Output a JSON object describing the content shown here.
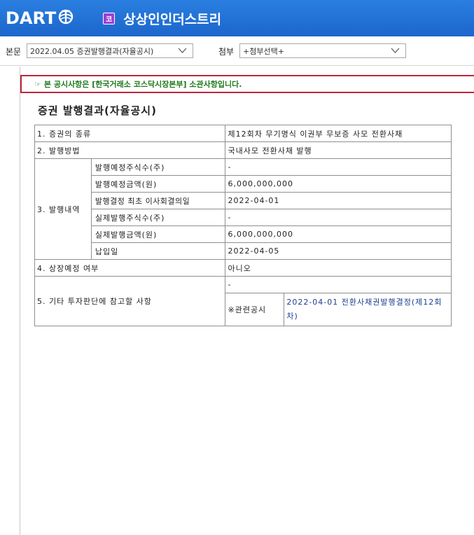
{
  "header": {
    "logo_text": "DART",
    "company_badge": "코",
    "company_name": "상상인인더스트리"
  },
  "toolbar": {
    "main_label": "본문",
    "main_select": "2022.04.05  증권발행결과(자율공시)",
    "attach_label": "첨부",
    "attach_select": "+첨부선택+"
  },
  "notice": {
    "icon": "pointing-hand-icon",
    "text": "본 공시사항은 [한국거래소 코스닥시장본부] 소관사항입니다."
  },
  "document": {
    "title": "증권 발행결과(자율공시)",
    "rows": {
      "r1_label": "1. 증권의 종류",
      "r1_value": "제12회차 무기명식 이권부 무보증 사모 전환사채",
      "r2_label": "2. 발행방법",
      "r2_value": "국내사모 전환사채 발행",
      "r3_label": "3. 발행내역",
      "r3_items": [
        {
          "label": "발행예정주식수(주)",
          "value": "-"
        },
        {
          "label": "발행예정금액(원)",
          "value": "6,000,000,000"
        },
        {
          "label": "발행결정 최초 이사회결의일",
          "value": "2022-04-01"
        },
        {
          "label": "실제발행주식수(주)",
          "value": "-"
        },
        {
          "label": "실제발행금액(원)",
          "value": "6,000,000,000"
        },
        {
          "label": "납입일",
          "value": "2022-04-05"
        }
      ],
      "r4_label": "4. 상장예정 여부",
      "r4_value": "아니오",
      "r5_label": "5. 기타 투자판단에 참고할 사항",
      "r5_value": "-",
      "r5_related_label": "※관련공시",
      "r5_related_value": "2022-04-01 전환사채권발행결정(제12회차)"
    }
  },
  "colors": {
    "header_blue": "#1c66cc",
    "notice_border": "#c0253a",
    "notice_text": "#1e7a1e"
  }
}
